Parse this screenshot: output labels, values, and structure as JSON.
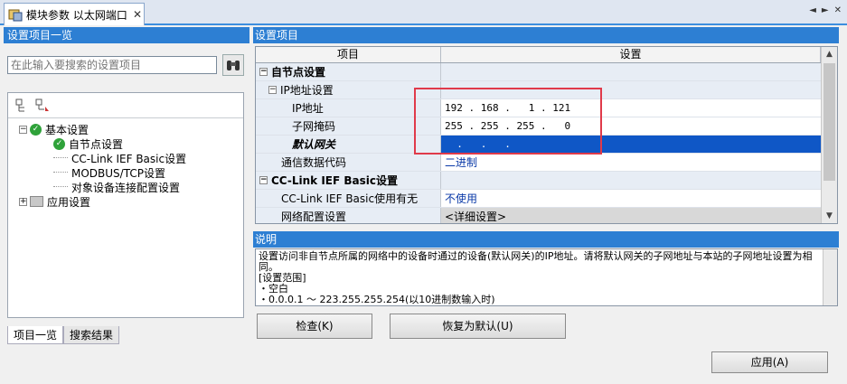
{
  "tab": {
    "title": "模块参数 以太网端口",
    "close": "✕"
  },
  "window_controls": {
    "prev": "◄",
    "next": "►",
    "close": "✕"
  },
  "left_panel": {
    "header": "设置项目一览",
    "search_placeholder": "在此输入要搜索的设置项目",
    "tree": [
      {
        "label": "基本设置",
        "expander": "−"
      },
      {
        "label": "自节点设置"
      },
      {
        "label": "CC-Link IEF Basic设置"
      },
      {
        "label": "MODBUS/TCP设置"
      },
      {
        "label": "对象设备连接配置设置"
      },
      {
        "label": "应用设置",
        "expander": "+"
      }
    ],
    "bottom_tabs": [
      "项目一览",
      "搜索结果"
    ]
  },
  "grid": {
    "header": "设置项目",
    "columns": [
      "项目",
      "设置"
    ],
    "rows": [
      {
        "item": "自节点设置",
        "value": "",
        "expander": "−"
      },
      {
        "item": "IP地址设置",
        "value": "",
        "expander": "−"
      },
      {
        "item": "IP地址",
        "value": "192 . 168 .   1 . 121"
      },
      {
        "item": "子网掩码",
        "value": "255 . 255 . 255 .   0"
      },
      {
        "item": "默认网关",
        "value": "  .   .   ."
      },
      {
        "item": "通信数据代码",
        "value": "二进制"
      },
      {
        "item": "CC-Link IEF Basic设置",
        "value": "",
        "expander": "−"
      },
      {
        "item": "CC-Link IEF Basic使用有无",
        "value": "不使用"
      },
      {
        "item": "网络配置设置",
        "value": "<详细设置>"
      }
    ]
  },
  "description": {
    "header": "说明",
    "lines": [
      "设置访问非自节点所属的网络中的设备时通过的设备(默认网关)的IP地址。请将默认网关的子网地址与本站的子网地址设置为相同。",
      "[设置范围]",
      "・空白",
      "・0.0.0.1 ～ 223.255.255.254(以10进制数输入时)"
    ]
  },
  "buttons": {
    "check": "检查(K)",
    "restore": "恢复为默认(U)",
    "apply": "应用(A)"
  },
  "colors": {
    "accent": "#2d7fd3",
    "selection": "#0f57c6",
    "highlight_box": "#e03a4a"
  }
}
